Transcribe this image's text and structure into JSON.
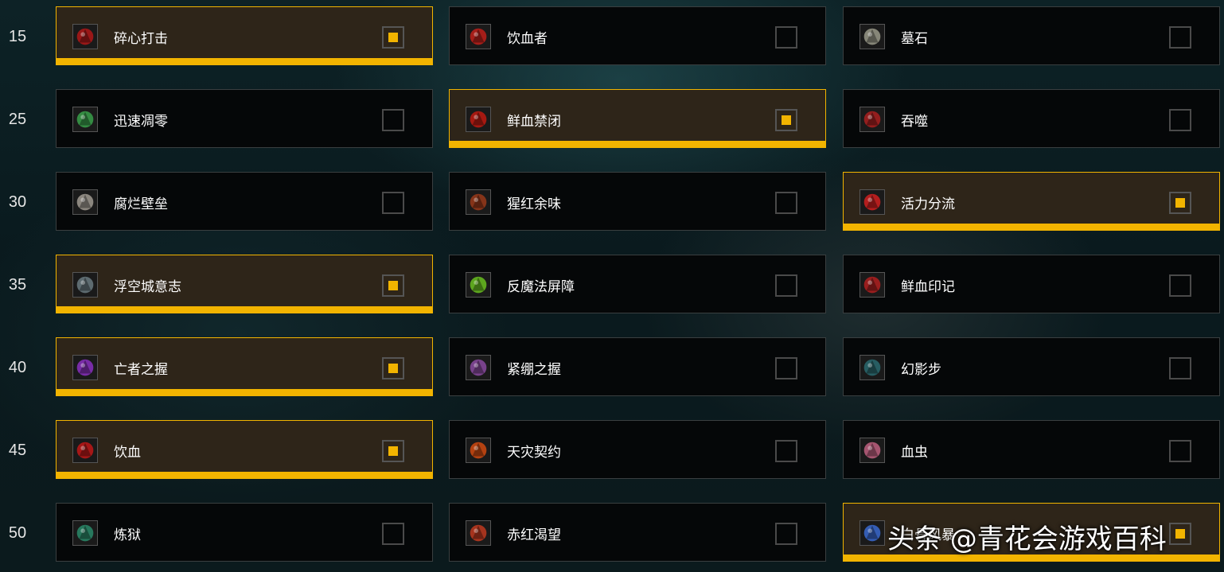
{
  "rows": [
    {
      "level": "15",
      "talents": [
        {
          "name": "碎心打击",
          "selected": true,
          "icon": "red-axe-icon",
          "icon_color": "#b01818"
        },
        {
          "name": "饮血者",
          "selected": false,
          "icon": "blood-drinker-icon",
          "icon_color": "#c0201a"
        },
        {
          "name": "墓石",
          "selected": false,
          "icon": "tombstone-skull-icon",
          "icon_color": "#9a9a8a"
        }
      ]
    },
    {
      "level": "25",
      "talents": [
        {
          "name": "迅速凋零",
          "selected": false,
          "icon": "green-claws-icon",
          "icon_color": "#3aa04a"
        },
        {
          "name": "鲜血禁闭",
          "selected": true,
          "icon": "blood-orb-icon",
          "icon_color": "#c01a10"
        },
        {
          "name": "吞噬",
          "selected": false,
          "icon": "devour-skull-icon",
          "icon_color": "#aa2020"
        }
      ]
    },
    {
      "level": "30",
      "talents": [
        {
          "name": "腐烂壁垒",
          "selected": false,
          "icon": "bone-shield-icon",
          "icon_color": "#a09a90"
        },
        {
          "name": "猩红余味",
          "selected": false,
          "icon": "crimson-skull-icon",
          "icon_color": "#9a3a1a"
        },
        {
          "name": "活力分流",
          "selected": true,
          "icon": "vitality-icon",
          "icon_color": "#d02020"
        }
      ]
    },
    {
      "level": "35",
      "talents": [
        {
          "name": "浮空城意志",
          "selected": true,
          "icon": "armored-knight-icon",
          "icon_color": "#6a7a80"
        },
        {
          "name": "反魔法屏障",
          "selected": false,
          "icon": "green-shield-icon",
          "icon_color": "#6ac020"
        },
        {
          "name": "鲜血印记",
          "selected": false,
          "icon": "blood-mark-icon",
          "icon_color": "#b02020"
        }
      ]
    },
    {
      "level": "40",
      "talents": [
        {
          "name": "亡者之握",
          "selected": true,
          "icon": "purple-grip-icon",
          "icon_color": "#8a30c0"
        },
        {
          "name": "紧绷之握",
          "selected": false,
          "icon": "tight-grip-icon",
          "icon_color": "#8a4aa0"
        },
        {
          "name": "幻影步",
          "selected": false,
          "icon": "wraith-walk-icon",
          "icon_color": "#2a6a70"
        }
      ]
    },
    {
      "level": "45",
      "talents": [
        {
          "name": "饮血",
          "selected": true,
          "icon": "blood-tap-icon",
          "icon_color": "#c01818"
        },
        {
          "name": "天灾契约",
          "selected": false,
          "icon": "scourge-pact-icon",
          "icon_color": "#d04a10"
        },
        {
          "name": "血虫",
          "selected": false,
          "icon": "blood-worm-icon",
          "icon_color": "#c06080"
        }
      ]
    },
    {
      "level": "50",
      "talents": [
        {
          "name": "炼狱",
          "selected": false,
          "icon": "purgatory-ring-icon",
          "icon_color": "#2a8a6a"
        },
        {
          "name": "赤红渴望",
          "selected": false,
          "icon": "red-thirst-icon",
          "icon_color": "#c03a20"
        },
        {
          "name": "白骨风暴",
          "selected": true,
          "icon": "bonestorm-icon",
          "icon_color": "#3a6ad0"
        }
      ]
    }
  ],
  "watermark": "头条 @青花会游戏百科",
  "colors": {
    "accent": "#f2b400",
    "selected_bg": "#2e2519",
    "cell_bg": "#050708"
  }
}
